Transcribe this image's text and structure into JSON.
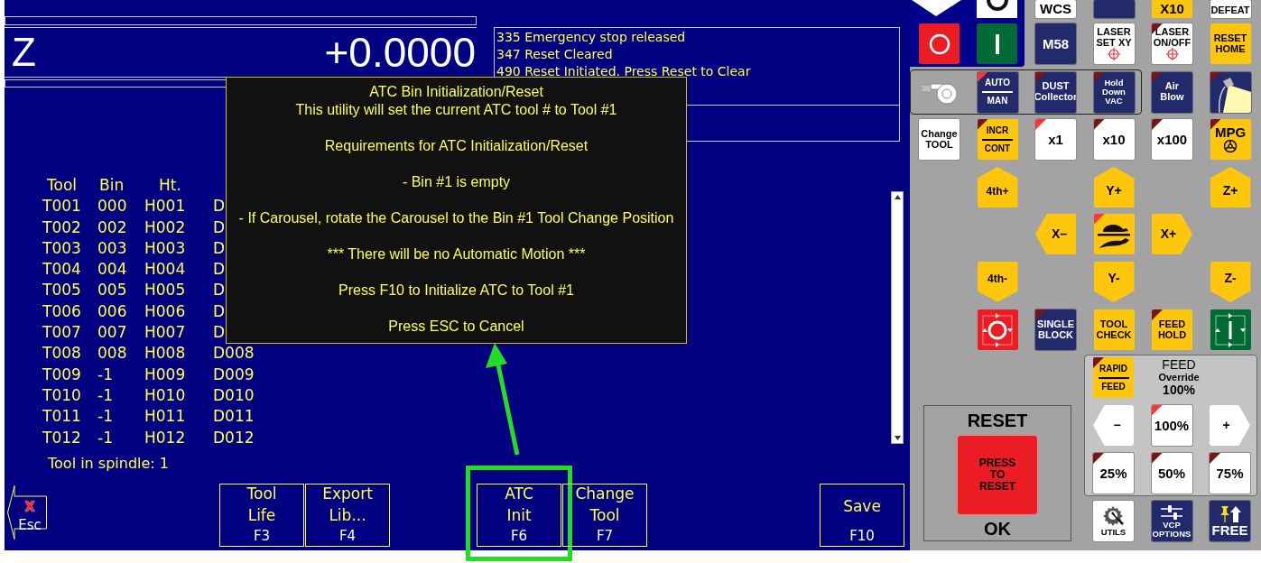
{
  "dro": {
    "axis": "Z",
    "value": "+0.0000"
  },
  "messages": [
    "335 Emergency stop released",
    "347 Reset Cleared",
    "490 Reset Initiated. Press Reset to Clear"
  ],
  "tool_table": {
    "columns": [
      "Tool",
      "Bin",
      "Ht."
    ],
    "rows": [
      [
        "T001",
        "000",
        "H001",
        "D"
      ],
      [
        "T002",
        "002",
        "H002",
        "D"
      ],
      [
        "T003",
        "003",
        "H003",
        "D"
      ],
      [
        "T004",
        "004",
        "H004",
        "D"
      ],
      [
        "T005",
        "005",
        "H005",
        "D"
      ],
      [
        "T006",
        "006",
        "H006",
        "D"
      ],
      [
        "T007",
        "007",
        "H007",
        "D"
      ],
      [
        "T008",
        "008",
        "H008",
        "D008"
      ],
      [
        "T009",
        "-1",
        "H009",
        "D009"
      ],
      [
        "T010",
        "-1",
        "H010",
        "D010"
      ],
      [
        "T011",
        "-1",
        "H011",
        "D011"
      ],
      [
        "T012",
        "-1",
        "H012",
        "D012"
      ]
    ]
  },
  "spindle_status": "Tool in spindle: 1",
  "dialog": {
    "paragraphs": [
      [
        "ATC Bin Initialization/Reset",
        "This utility will set the current ATC tool # to Tool #1"
      ],
      [
        "Requirements for ATC Initialization/Reset"
      ],
      [
        "- Bin #1 is empty"
      ],
      [
        "- If Carousel, rotate the Carousel to the Bin #1 Tool Change Position"
      ],
      [
        "*** There will be no Automatic Motion ***"
      ],
      [
        "Press F10 to Initialize ATC to Tool #1"
      ],
      [
        "Press ESC to Cancel"
      ]
    ]
  },
  "function_keys": [
    {
      "kind": "back",
      "mark": "X",
      "label": [
        "Esc"
      ],
      "highlighted": false
    },
    {
      "kind": "key",
      "label": [
        "Tool",
        "Life"
      ],
      "key": "F3",
      "highlighted": false
    },
    {
      "kind": "key",
      "label": [
        "Export",
        "Lib..."
      ],
      "key": "F4",
      "highlighted": false
    },
    {
      "kind": "key",
      "label": [
        "ATC",
        "Init"
      ],
      "key": "F6",
      "highlighted": true
    },
    {
      "kind": "key",
      "label": [
        "Change",
        "Tool"
      ],
      "key": "F7",
      "highlighted": false
    },
    {
      "kind": "key",
      "label": [
        "Save"
      ],
      "key": "F10",
      "highlighted": false
    }
  ],
  "panel": {
    "top_partial": [
      {
        "kind": "text",
        "lines": [
          "WCS"
        ]
      },
      {
        "kind": "plain"
      },
      {
        "kind": "text",
        "lines": [
          "X10"
        ]
      },
      {
        "kind": "text",
        "lines": [
          "DEFEAT"
        ]
      }
    ],
    "power": [
      {
        "kind": "icon"
      },
      {
        "kind": "icon"
      }
    ],
    "row_a": [
      {
        "kind": "text",
        "lines": [
          "M58"
        ]
      },
      {
        "kind": "text",
        "lines": [
          "LASER",
          "SET XY"
        ]
      },
      {
        "kind": "text",
        "lines": [
          "LASER",
          "ON/OFF"
        ],
        "led_on": false
      },
      {
        "kind": "text",
        "lines": [
          "RESET",
          "HOME"
        ]
      }
    ],
    "aux_group": [
      {
        "kind": "icon"
      },
      {
        "kind": "split",
        "lines": [
          "AUTO",
          "MAN"
        ],
        "led_on": true
      },
      {
        "kind": "text",
        "lines": [
          "DUST",
          "Collector"
        ],
        "led_on": false
      },
      {
        "kind": "text",
        "lines": [
          "Hold",
          "Down",
          "VAC"
        ],
        "led_on": false
      }
    ],
    "aux_extra": [
      {
        "kind": "text",
        "lines": [
          "Air",
          "Blow"
        ],
        "led_on": false
      },
      {
        "kind": "icon",
        "led_on": false
      }
    ],
    "row_b": [
      {
        "kind": "text",
        "lines": [
          "Change",
          "TOOL"
        ]
      },
      {
        "kind": "split",
        "lines": [
          "INCR",
          "CONT"
        ],
        "led_on": false
      },
      {
        "kind": "text",
        "lines": [
          "x1"
        ],
        "led_on": true
      },
      {
        "kind": "text",
        "lines": [
          "x10"
        ],
        "led_on": false
      },
      {
        "kind": "text",
        "lines": [
          "x100"
        ],
        "led_on": false
      },
      {
        "kind": "text",
        "lines": [
          "MPG"
        ],
        "led_on": false
      }
    ],
    "jog": [
      {
        "kind": "up",
        "lines": [
          "4th+"
        ]
      },
      {
        "kind": "up",
        "lines": [
          "Y+"
        ]
      },
      {
        "kind": "up",
        "lines": [
          "Z+"
        ]
      },
      {
        "kind": "left",
        "lines": [
          "X–"
        ]
      },
      {
        "kind": "icon",
        "led_on": true
      },
      {
        "kind": "right",
        "lines": [
          "X+"
        ]
      },
      {
        "kind": "down",
        "lines": [
          "4th-"
        ]
      },
      {
        "kind": "down",
        "lines": [
          "Y-"
        ]
      },
      {
        "kind": "down",
        "lines": [
          "Z-"
        ]
      }
    ],
    "cycle": [
      {
        "kind": "icon"
      },
      {
        "kind": "text",
        "lines": [
          "SINGLE",
          "BLOCK"
        ],
        "led_on": false
      },
      {
        "kind": "text",
        "lines": [
          "TOOL",
          "CHECK"
        ]
      },
      {
        "kind": "text",
        "lines": [
          "FEED",
          "HOLD"
        ],
        "led_on": false
      },
      {
        "kind": "icon"
      }
    ],
    "reset": {
      "title": "RESET",
      "button": [
        "PRESS",
        "TO",
        "RESET"
      ],
      "status": "OK"
    },
    "feed": {
      "rapid": {
        "kind": "split",
        "lines": [
          "RAPID",
          "FEED"
        ],
        "led_on": false
      },
      "title": "FEED",
      "subtitle": "Override",
      "value": "100%",
      "buttons": [
        {
          "kind": "left",
          "lines": [
            "−"
          ]
        },
        {
          "kind": "text",
          "lines": [
            "100%"
          ],
          "led_on": true
        },
        {
          "kind": "right",
          "lines": [
            "+"
          ]
        },
        {
          "kind": "text",
          "lines": [
            "25%"
          ],
          "led_on": false
        },
        {
          "kind": "text",
          "lines": [
            "50%"
          ],
          "led_on": false
        },
        {
          "kind": "text",
          "lines": [
            "75%"
          ],
          "led_on": false
        }
      ]
    },
    "utilities": [
      {
        "kind": "text",
        "lines": [
          "UTILS"
        ]
      },
      {
        "kind": "text",
        "lines": [
          "VCP",
          "OPTIONS"
        ]
      },
      {
        "kind": "text",
        "lines": [
          "FREE"
        ]
      }
    ]
  }
}
